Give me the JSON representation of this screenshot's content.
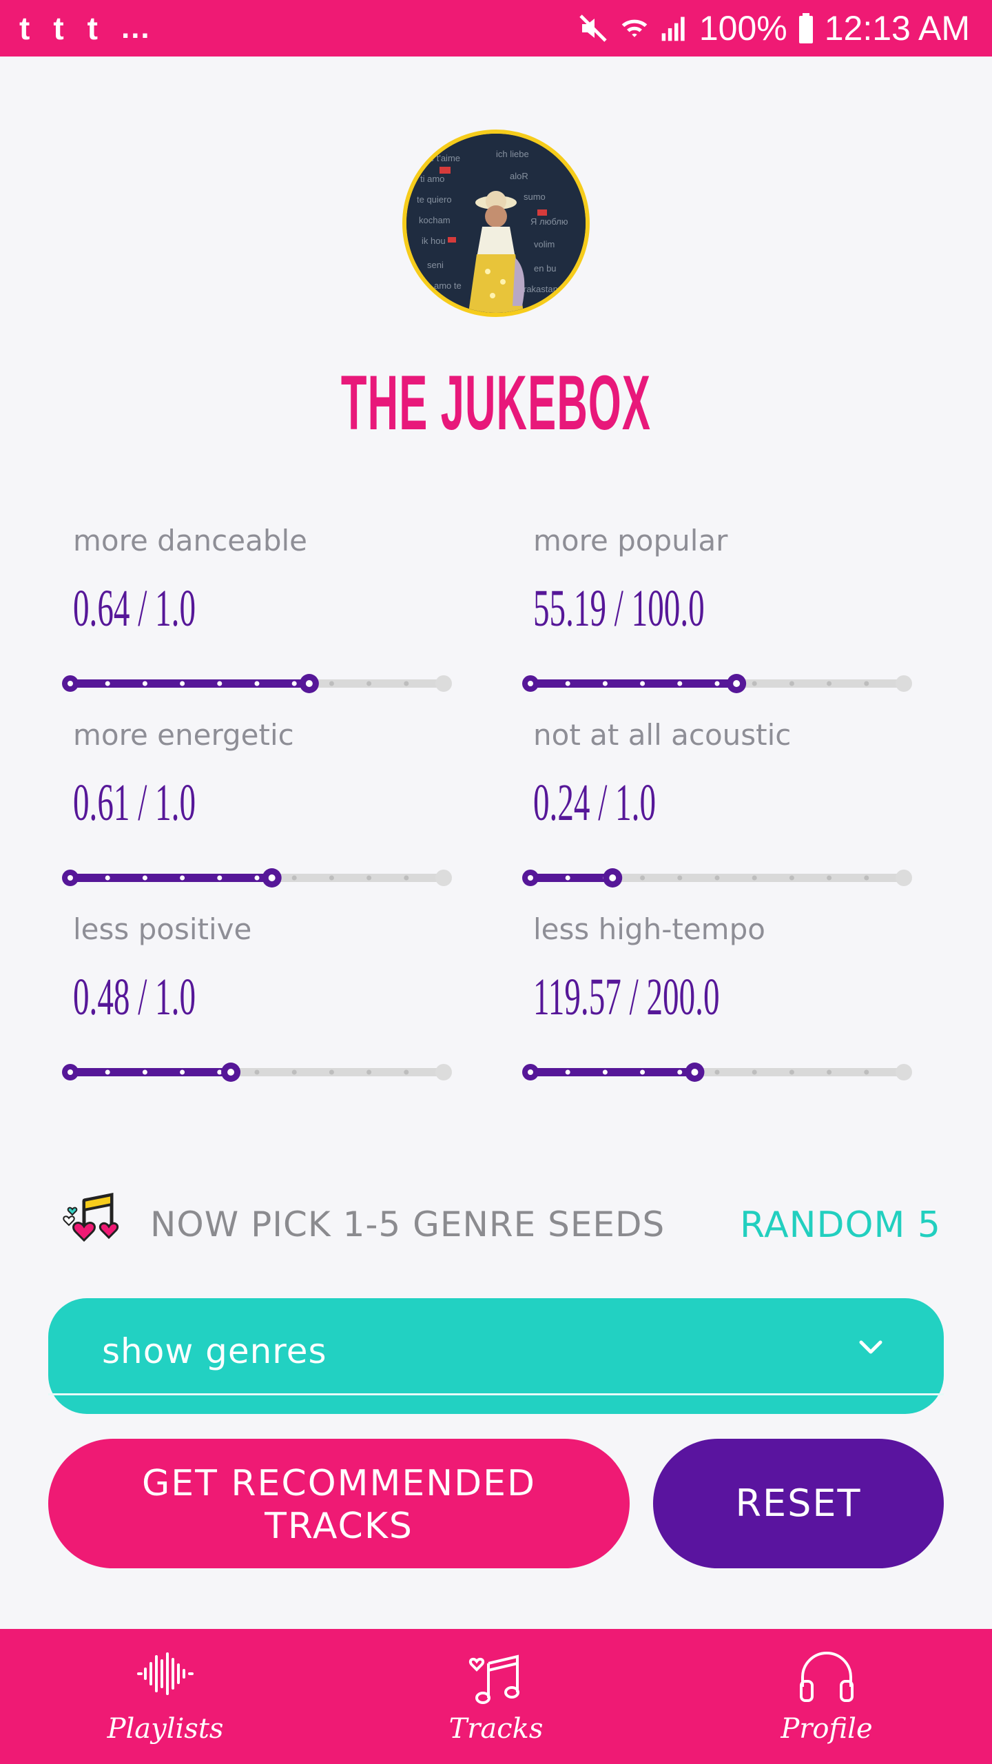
{
  "status_bar": {
    "notifications": [
      "t",
      "t",
      "t"
    ],
    "overflow": "...",
    "battery": "100%",
    "time": "12:13 AM",
    "icons": [
      "mute-icon",
      "wifi-icon",
      "signal-icon",
      "battery-icon"
    ]
  },
  "profile": {
    "title": "THE JUKEBOX"
  },
  "sliders": [
    {
      "label": "more danceable",
      "value_text": "0.64 / 1.0",
      "fraction": 0.64
    },
    {
      "label": "more popular",
      "value_text": "55.19 / 100.0",
      "fraction": 0.5519
    },
    {
      "label": "more energetic",
      "value_text": "0.61 / 1.0",
      "fraction": 0.54
    },
    {
      "label": "not at all acoustic",
      "value_text": "0.24 / 1.0",
      "fraction": 0.22
    },
    {
      "label": "less positive",
      "value_text": "0.48 / 1.0",
      "fraction": 0.43
    },
    {
      "label": "less high-tempo",
      "value_text": "119.57 / 200.0",
      "fraction": 0.44
    }
  ],
  "genre_seeds": {
    "prompt": "NOW PICK 1-5 GENRE SEEDS",
    "random_label": "RANDOM 5",
    "icon": "music-note-hearts-icon"
  },
  "genre_select": {
    "label": "show genres"
  },
  "actions": {
    "recommend_line1": "GET RECOMMENDED",
    "recommend_line2": "TRACKS",
    "reset": "RESET"
  },
  "bottom_nav": {
    "items": [
      {
        "label": "Playlists",
        "icon": "waveform-icon"
      },
      {
        "label": "Tracks",
        "icon": "music-notes-icon"
      },
      {
        "label": "Profile",
        "icon": "headphones-icon"
      }
    ]
  },
  "colors": {
    "primary_pink": "#ef1a74",
    "purple": "#5a149f",
    "teal": "#22d1c2",
    "slider_fill": "#561798",
    "slider_track": "#d9d9d9"
  }
}
